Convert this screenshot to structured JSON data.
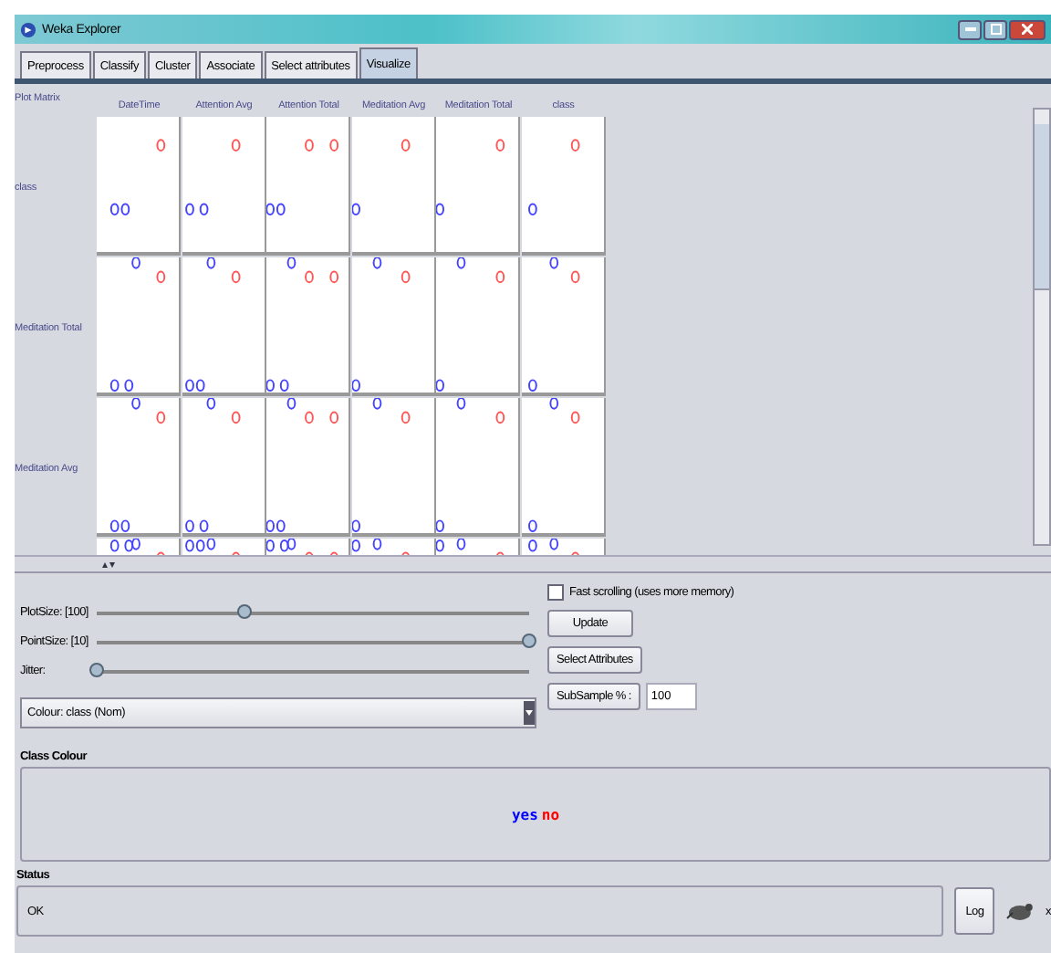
{
  "window": {
    "title": "Weka Explorer"
  },
  "tabs": [
    {
      "label": "Preprocess",
      "selected": false
    },
    {
      "label": "Classify",
      "selected": false
    },
    {
      "label": "Cluster",
      "selected": false
    },
    {
      "label": "Associate",
      "selected": false
    },
    {
      "label": "Select attributes",
      "selected": false
    },
    {
      "label": "Visualize",
      "selected": true
    }
  ],
  "plot_matrix": {
    "title": "Plot Matrix",
    "columns": [
      "DateTime",
      "Attention Avg",
      "Attention Total",
      "Meditation Avg",
      "Meditation Total",
      "class"
    ],
    "rows": [
      "class",
      "Meditation Total",
      "Meditation Avg"
    ]
  },
  "controls": {
    "plot_size": {
      "label": "PlotSize: [100]",
      "level": 0.34
    },
    "point_size": {
      "label": "PointSize: [10]",
      "level": 1.0
    },
    "jitter": {
      "label": "Jitter:",
      "level": 0.0
    },
    "colour_select": "Colour: class (Nom)",
    "fast_scrolling": {
      "label": "Fast scrolling (uses more memory)",
      "checked": false
    },
    "update_button": "Update",
    "select_attributes_button": "Select Attributes",
    "subsample_button": "SubSample % :",
    "subsample_value": "100"
  },
  "class_colour": {
    "title": "Class Colour",
    "classes": [
      {
        "label": "yes",
        "color": "#0000ff"
      },
      {
        "label": "no",
        "color": "#ff0000"
      }
    ]
  },
  "status": {
    "title": "Status",
    "message": "OK",
    "log_button": "Log",
    "count": "x"
  }
}
